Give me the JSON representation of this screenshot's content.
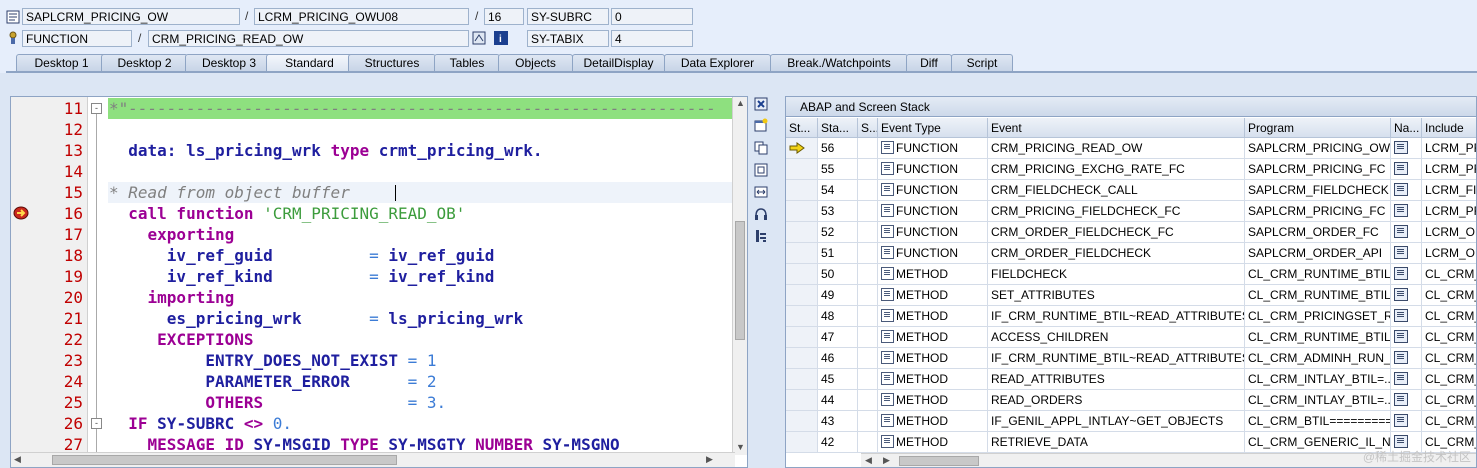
{
  "header": {
    "row1": {
      "program": "SAPLCRM_PRICING_OW",
      "separator": "/",
      "include": "LCRM_PRICING_OWU08",
      "separator2": "/",
      "line": "16",
      "sysfield": "SY-SUBRC",
      "sysvalue": "0"
    },
    "row2": {
      "event_type": "FUNCTION",
      "separator": "/",
      "event": "CRM_PRICING_READ_OW",
      "sysfield": "SY-TABIX",
      "sysvalue": "4"
    }
  },
  "tabs": [
    "Desktop 1",
    "Desktop 2",
    "Desktop 3",
    "Standard",
    "Structures",
    "Tables",
    "Objects",
    "DetailDisplay",
    "Data Explorer",
    "Break./Watchpoints",
    "Diff",
    "Script"
  ],
  "active_tab": "Standard",
  "editor": {
    "lines": [
      {
        "no": "11"
      },
      {
        "no": "12"
      },
      {
        "no": "13"
      },
      {
        "no": "14"
      },
      {
        "no": "15"
      },
      {
        "no": "16"
      },
      {
        "no": "17"
      },
      {
        "no": "18"
      },
      {
        "no": "19"
      },
      {
        "no": "20"
      },
      {
        "no": "21"
      },
      {
        "no": "22"
      },
      {
        "no": "23"
      },
      {
        "no": "24"
      },
      {
        "no": "25"
      },
      {
        "no": "26"
      },
      {
        "no": "27"
      }
    ],
    "text": {
      "l11": "*\"-------------------------------------------------------------",
      "l13a": "data:",
      "l13b": "ls_pricing_wrk",
      "l13c": "type",
      "l13d": "crmt_pricing_wrk.",
      "l15": "* Read from object buffer",
      "l16a": "call function",
      "l16b": "'CRM_PRICING_READ_OB'",
      "l17": "exporting",
      "l18a": "iv_ref_guid",
      "l18b": "=",
      "l18c": "iv_ref_guid",
      "l19a": "iv_ref_kind",
      "l19b": "=",
      "l19c": "iv_ref_kind",
      "l20": "importing",
      "l21a": "es_pricing_wrk",
      "l21b": "=",
      "l21c": "ls_pricing_wrk",
      "l22": "EXCEPTIONS",
      "l23a": "ENTRY_DOES_NOT_EXIST",
      "l23b": "=",
      "l23c": "1",
      "l24a": "PARAMETER_ERROR",
      "l24b": "=",
      "l24c": "2",
      "l25a": "OTHERS",
      "l25b": "=",
      "l25c": "3.",
      "l26a": "IF",
      "l26b": "SY-SUBRC",
      "l26c": "<>",
      "l26d": "0.",
      "l27a": "MESSAGE",
      "l27b": "ID",
      "l27c": "SY-MSGID",
      "l27d": "TYPE",
      "l27e": "SY-MSGTY",
      "l27f": "NUMBER",
      "l27g": "SY-MSGNO"
    }
  },
  "stack": {
    "title": "ABAP and Screen Stack",
    "columns": [
      "St...",
      "Sta...",
      "S...",
      "Event Type",
      "Event",
      "Program",
      "Na...",
      "Include"
    ],
    "rows": [
      {
        "level": "56",
        "type": "FUNCTION",
        "event": "CRM_PRICING_READ_OW",
        "program": "SAPLCRM_PRICING_OW",
        "include": "LCRM_PRI",
        "current": true
      },
      {
        "level": "55",
        "type": "FUNCTION",
        "event": "CRM_PRICING_EXCHG_RATE_FC",
        "program": "SAPLCRM_PRICING_FC",
        "include": "LCRM_PRI"
      },
      {
        "level": "54",
        "type": "FUNCTION",
        "event": "CRM_FIELDCHECK_CALL",
        "program": "SAPLCRM_FIELDCHECK",
        "include": "LCRM_FIE"
      },
      {
        "level": "53",
        "type": "FUNCTION",
        "event": "CRM_PRICING_FIELDCHECK_FC",
        "program": "SAPLCRM_PRICING_FC",
        "include": "LCRM_PRI"
      },
      {
        "level": "52",
        "type": "FUNCTION",
        "event": "CRM_ORDER_FIELDCHECK_FC",
        "program": "SAPLCRM_ORDER_FC",
        "include": "LCRM_OR"
      },
      {
        "level": "51",
        "type": "FUNCTION",
        "event": "CRM_ORDER_FIELDCHECK",
        "program": "SAPLCRM_ORDER_API",
        "include": "LCRM_OR"
      },
      {
        "level": "50",
        "type": "METHOD",
        "event": "FIELDCHECK",
        "program": "CL_CRM_RUNTIME_BTIL...",
        "include": "CL_CRM_R"
      },
      {
        "level": "49",
        "type": "METHOD",
        "event": "SET_ATTRIBUTES",
        "program": "CL_CRM_RUNTIME_BTIL...",
        "include": "CL_CRM_R"
      },
      {
        "level": "48",
        "type": "METHOD",
        "event": "IF_CRM_RUNTIME_BTIL~READ_ATTRIBUTES",
        "program": "CL_CRM_PRICINGSET_R...",
        "include": "CL_CRM_P"
      },
      {
        "level": "47",
        "type": "METHOD",
        "event": "ACCESS_CHILDREN",
        "program": "CL_CRM_RUNTIME_BTIL...",
        "include": "CL_CRM_R"
      },
      {
        "level": "46",
        "type": "METHOD",
        "event": "IF_CRM_RUNTIME_BTIL~READ_ATTRIBUTES",
        "program": "CL_CRM_ADMINH_RUN_...",
        "include": "CL_CRM_A"
      },
      {
        "level": "45",
        "type": "METHOD",
        "event": "READ_ATTRIBUTES",
        "program": "CL_CRM_INTLAY_BTIL=...",
        "include": "CL_CRM_I"
      },
      {
        "level": "44",
        "type": "METHOD",
        "event": "READ_ORDERS",
        "program": "CL_CRM_INTLAY_BTIL=...",
        "include": "CL_CRM_I"
      },
      {
        "level": "43",
        "type": "METHOD",
        "event": "IF_GENIL_APPL_INTLAY~GET_OBJECTS",
        "program": "CL_CRM_BTIL=========...",
        "include": "CL_CRM_B"
      },
      {
        "level": "42",
        "type": "METHOD",
        "event": "RETRIEVE_DATA",
        "program": "CL_CRM_GENERIC_IL_NE...",
        "include": "CL_CRM_G"
      }
    ]
  },
  "watermark": "@稀土掘金技术社区"
}
